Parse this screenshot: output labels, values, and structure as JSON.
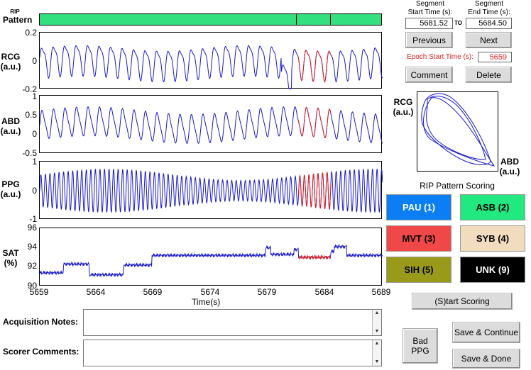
{
  "rip_pattern": {
    "label_small": "RIP",
    "label": "Pattern",
    "bar_color": "#33e080"
  },
  "plots": {
    "rcg": {
      "label": "RCG\n(a.u.)",
      "ticks": [
        "0.2",
        "0",
        "-0.2"
      ]
    },
    "abd": {
      "label": "ABD\n(a.u.)",
      "ticks": [
        "1",
        "0.5",
        "0",
        "-0.5"
      ]
    },
    "ppg": {
      "label": "PPG\n(a.u.)",
      "ticks": [
        "1",
        "0",
        "-1"
      ]
    },
    "sat": {
      "label": "SAT\n(%)",
      "ticks": [
        "96",
        "94",
        "92",
        "90"
      ]
    }
  },
  "xaxis": {
    "ticks": [
      "5659",
      "5664",
      "5669",
      "5674",
      "5679",
      "5684",
      "5689"
    ],
    "label": "Time(s)"
  },
  "segment": {
    "start_label": "Segment\nStart Time (s):",
    "end_label": "Segment\nEnd Time (s):",
    "start_value": "5681.52",
    "to_label": "TO",
    "end_value": "5684.50",
    "previous": "Previous",
    "next": "Next",
    "epoch_label": "Epoch Start Time (s):",
    "epoch_value": "5659",
    "comment": "Comment",
    "delete": "Delete"
  },
  "loop_plot": {
    "ylabel": "RCG\n(a.u.)",
    "xlabel": "ABD\n(a.u.)"
  },
  "scoring": {
    "title": "RIP Pattern Scoring",
    "buttons": [
      {
        "label": "PAU (1)",
        "bg": "#0a7ef2",
        "fg": "#ffffff"
      },
      {
        "label": "ASB (2)",
        "bg": "#22e880",
        "fg": "#000000"
      },
      {
        "label": "MVT (3)",
        "bg": "#f04848",
        "fg": "#000000"
      },
      {
        "label": "SYB (4)",
        "bg": "#f2dcc0",
        "fg": "#000000"
      },
      {
        "label": "SIH (5)",
        "bg": "#9a9a1a",
        "fg": "#000000"
      },
      {
        "label": "UNK (9)",
        "bg": "#000000",
        "fg": "#ffffff"
      }
    ],
    "start_scoring": "(S)tart Scoring"
  },
  "bottom": {
    "acq_label": "Acquisition Notes:",
    "scorer_label": "Scorer Comments:",
    "bad_ppg": "Bad\nPPG",
    "save_continue": "Save & Continue",
    "save_done": "Save & Done"
  },
  "colors": {
    "signal": "#1a1acc",
    "highlight": "#e02020"
  }
}
